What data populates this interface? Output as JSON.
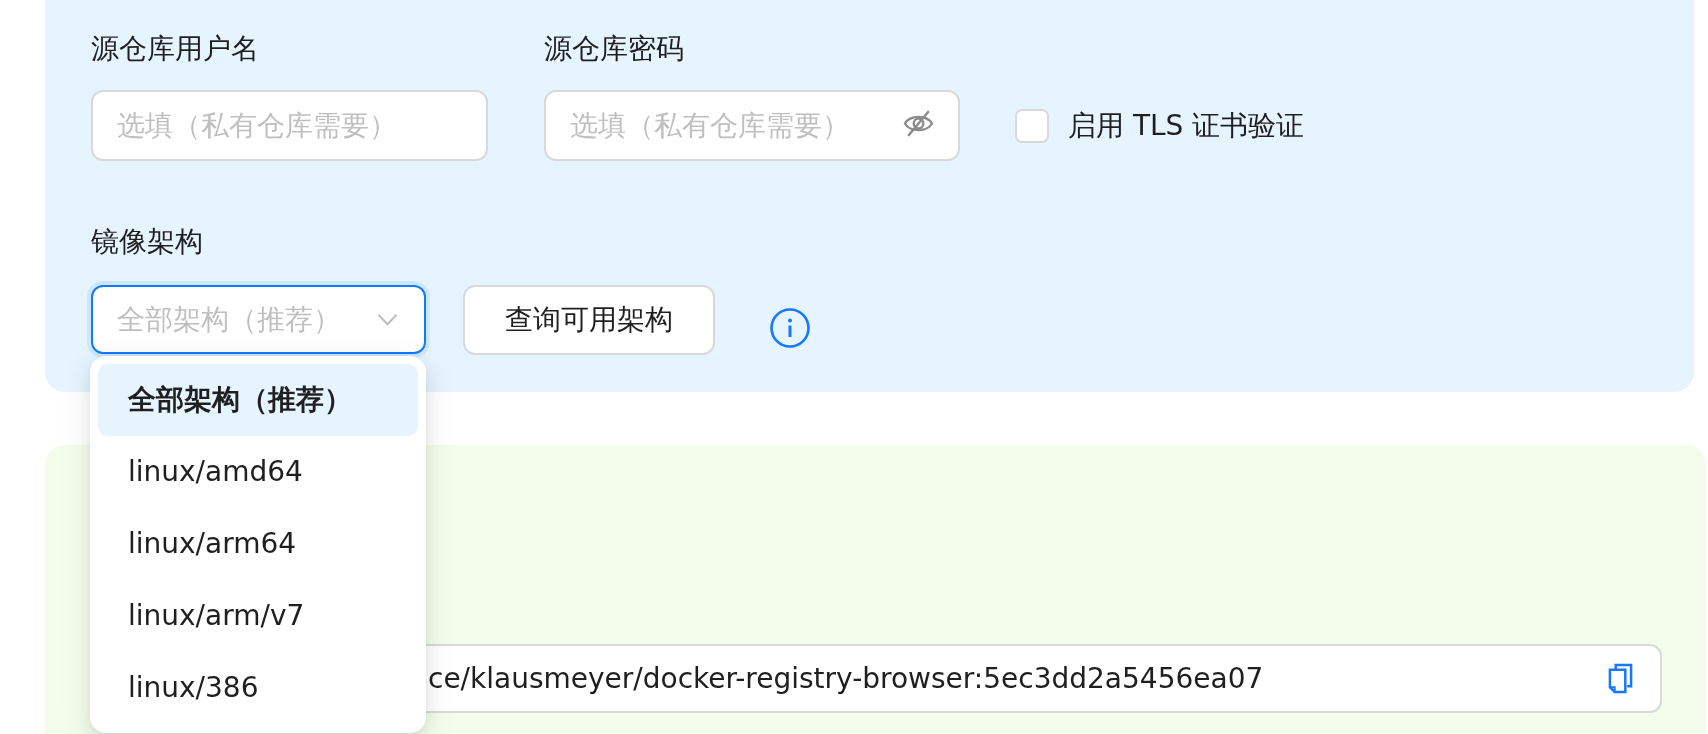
{
  "credentials": {
    "username": {
      "label": "源仓库用户名",
      "placeholder": "选填（私有仓库需要）"
    },
    "password": {
      "label": "源仓库密码",
      "placeholder": "选填（私有仓库需要）",
      "visible": false
    },
    "tls_verify": {
      "label": "启用 TLS 证书验证",
      "checked": false
    }
  },
  "architecture": {
    "label": "镜像架构",
    "placeholder": "全部架构（推荐）",
    "expanded": true,
    "query_button": "查询可用架构",
    "options": [
      {
        "label": "全部架构（推荐）",
        "selected": true
      },
      {
        "label": "linux/amd64",
        "selected": false
      },
      {
        "label": "linux/arm64",
        "selected": false
      },
      {
        "label": "linux/arm/v7",
        "selected": false
      },
      {
        "label": "linux/386",
        "selected": false
      }
    ]
  },
  "result": {
    "image_reference": "ce/klausmeyer/docker-registry-browser:5ec3dd2a5456ea07"
  }
}
